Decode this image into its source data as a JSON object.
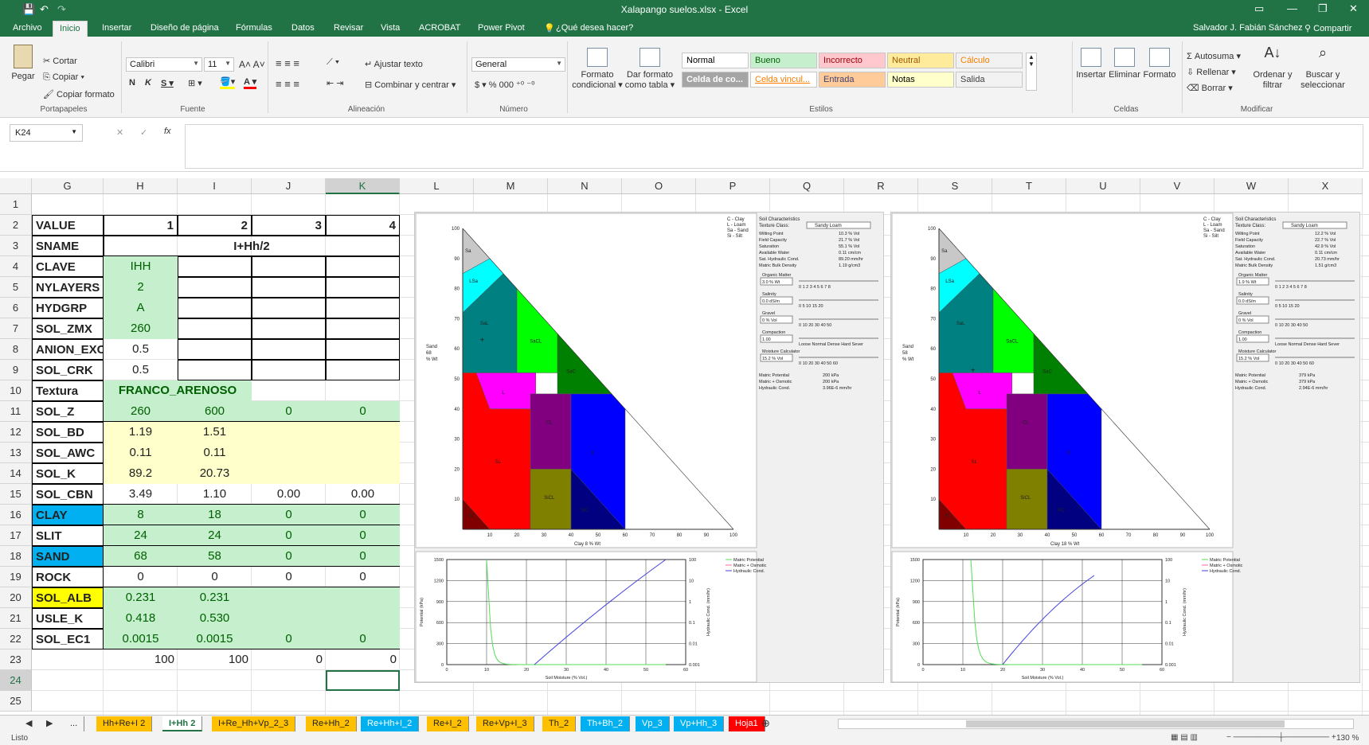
{
  "titlebar": {
    "title": "Xalapango suelos.xlsx - Excel",
    "save": "💾",
    "undo": "↶",
    "redo": "↷"
  },
  "ribbon_tabs": [
    "Archivo",
    "Inicio",
    "Insertar",
    "Diseño de página",
    "Fórmulas",
    "Datos",
    "Revisar",
    "Vista",
    "ACROBAT",
    "Power Pivot",
    "¿Qué desea hacer?"
  ],
  "user": {
    "name": "Salvador J. Fabián Sánchez",
    "share": "Compartir"
  },
  "clipboard": {
    "paste": "Pegar",
    "cut": "Cortar",
    "copy": "Copiar",
    "format_painter": "Copiar formato",
    "label": "Portapapeles"
  },
  "font": {
    "name": "Calibri",
    "size": "11",
    "label": "Fuente"
  },
  "alignment": {
    "wrap": "Ajustar texto",
    "merge": "Combinar y centrar",
    "label": "Alineación"
  },
  "number": {
    "format": "General",
    "label": "Número"
  },
  "styles": {
    "cond": "Formato condicional",
    "table": "Dar formato como tabla",
    "label": "Estilos",
    "cells": [
      "Normal",
      "Bueno",
      "Incorrecto",
      "Neutral",
      "Cálculo",
      "Celda de co...",
      "Celda vincul...",
      "Entrada",
      "Notas",
      "Salida"
    ],
    "colors": [
      "#ffffff",
      "#c6efce",
      "#ffc7ce",
      "#ffeb9c",
      "#f2f2f2",
      "#a5a5a5",
      "#ffffff",
      "#ffcc99",
      "#ffffcc",
      "#f2f2f2"
    ],
    "textcolors": [
      "#000000",
      "#006100",
      "#9c0006",
      "#9c5700",
      "#fa7d00",
      "#ffffff",
      "#fa7d00",
      "#3f3f76",
      "#000000",
      "#3f3f3f"
    ]
  },
  "cells_group": {
    "insert": "Insertar",
    "delete": "Eliminar",
    "format": "Formato",
    "label": "Celdas"
  },
  "editing": {
    "autosum": "Autosuma",
    "fill": "Rellenar",
    "clear": "Borrar",
    "sort": "Ordenar y filtrar",
    "find": "Buscar y seleccionar",
    "label": "Modificar"
  },
  "formula_bar": {
    "namebox": "K24",
    "fx": "fx",
    "content": ""
  },
  "columns": [
    "G",
    "H",
    "I",
    "J",
    "K",
    "L",
    "M",
    "N",
    "O",
    "P",
    "Q",
    "R",
    "S",
    "T",
    "U",
    "V",
    "W",
    "X"
  ],
  "rows": [
    "1",
    "2",
    "3",
    "4",
    "5",
    "6",
    "7",
    "8",
    "9",
    "10",
    "11",
    "12",
    "13",
    "14",
    "15",
    "16",
    "17",
    "18",
    "19",
    "20",
    "21",
    "22",
    "23",
    "24",
    "25"
  ],
  "table": {
    "labels": [
      "VALUE",
      "SNAME",
      "CLAVE",
      "NYLAYERS",
      "HYDGRP",
      "SOL_ZMX",
      "ANION_EXCL",
      "SOL_CRK",
      "Textura",
      "SOL_Z",
      "SOL_BD",
      "SOL_AWC",
      "SOL_K",
      "SOL_CBN",
      "CLAY",
      "SLIT",
      "SAND",
      "ROCK",
      "SOL_ALB",
      "USLE_K",
      "SOL_EC1"
    ],
    "value_row": [
      "1",
      "2",
      "3",
      "4"
    ],
    "sname": "I+Hh/2",
    "clave": "IHH",
    "nylayers": "2",
    "hydgrp": "A",
    "sol_zmx": "260",
    "anion_excl": "0.5",
    "sol_crk": "0.5",
    "textura": "FRANCO_ARENOSO",
    "sol_z": [
      "260",
      "600",
      "0",
      "0"
    ],
    "sol_bd": [
      "1.19",
      "1.51"
    ],
    "sol_awc": [
      "0.11",
      "0.11"
    ],
    "sol_k": [
      "89.2",
      "20.73"
    ],
    "sol_cbn": [
      "3.49",
      "1.10",
      "0.00",
      "0.00"
    ],
    "clay": [
      "8",
      "18",
      "0",
      "0"
    ],
    "slit": [
      "24",
      "24",
      "0",
      "0"
    ],
    "sand": [
      "68",
      "58",
      "0",
      "0"
    ],
    "rock": [
      "0",
      "0",
      "0",
      "0"
    ],
    "sol_alb": [
      "0.231",
      "0.231"
    ],
    "usle_k": [
      "0.418",
      "0.530"
    ],
    "sol_ec1": [
      "0.0015",
      "0.0015",
      "0",
      "0"
    ],
    "totals": [
      "100",
      "100",
      "0",
      "0"
    ]
  },
  "plots": [
    {
      "legend": [
        "C - Clay",
        "L - Loam",
        "Sa - Sand",
        "Si - Silt"
      ],
      "sand_label": "Sand",
      "sand_val": "68",
      "sand_unit": "% Wt",
      "clay_label": "Clay",
      "clay_val": "8",
      "clay_unit": "% Wt",
      "y_ticks": [
        "10",
        "20",
        "30",
        "40",
        "50",
        "60",
        "70",
        "80",
        "90",
        "100"
      ],
      "x_ticks": [
        "10",
        "20",
        "30",
        "40",
        "50",
        "60",
        "70",
        "80",
        "90",
        "100"
      ],
      "zones": [
        "Sa",
        "LSa",
        "SaL",
        "SaCL",
        "SaC",
        "L",
        "CL",
        "C",
        "SL",
        "SiCL",
        "SiC",
        "Si"
      ],
      "soil": {
        "header": "Soil Characteristics",
        "texture_class_label": "Texture Class:",
        "texture_class": "Sandy Loam",
        "rows": [
          [
            "Wilting Point",
            "10.3 % Vol"
          ],
          [
            "Field Capacity",
            "21.7 % Vol"
          ],
          [
            "Saturation",
            "55.1 % Vol"
          ],
          [
            "Available Water",
            "0.11 cm/cm"
          ],
          [
            "Sat. Hydraulic Cond.",
            "89.20 mm/hr"
          ],
          [
            "Matric Bulk Density",
            "1.19 g/cm3"
          ]
        ],
        "om_label": "Organic Matter",
        "om_val": "3.0 % Wt",
        "om_ticks": "0 1 2 3 4 5 6 7 8",
        "sal_label": "Salinity",
        "sal_val": "0.0 dS/m",
        "sal_ticks": "0 5 10 15 20",
        "grav_label": "Gravel",
        "grav_val": "0 % Vol",
        "grav_ticks": "0 10 20 30 40 50",
        "comp_label": "Compaction",
        "comp_val": "1.00",
        "comp_ticks": "Loose Normal Dense Hard Sever",
        "moist_label": "Moisture Calculator",
        "moist_val": "15.2 % Vol",
        "moist_ticks": "0 10 20 30 40 50 60",
        "moist_rows": [
          [
            "Matric Potential",
            "200 kPa"
          ],
          [
            "Matric + Osmotic",
            "200 kPa"
          ],
          [
            "Hydraulic Cond.",
            "3.96E-6 mm/hr"
          ]
        ]
      },
      "curve": {
        "legend": [
          "Matric Potential",
          "Matric + Osmotic",
          "Hydraulic Cond."
        ],
        "y_left": [
          "0",
          "300",
          "600",
          "900",
          "1200",
          "1500"
        ],
        "y_right": [
          "0.001",
          "0.01",
          "0.1",
          "1",
          "10",
          "100"
        ],
        "x": [
          "0",
          "10",
          "20",
          "30",
          "40",
          "50",
          "60"
        ],
        "xlabel": "Soil Moisture (% Vol.)",
        "ylabel": "Potential (kPa)",
        "y2label": "Hydraulic Cond. (mm/hr)"
      }
    },
    {
      "legend": [
        "C - Clay",
        "L - Loam",
        "Sa - Sand",
        "Si - Silt"
      ],
      "sand_label": "Sand",
      "sand_val": "58",
      "sand_unit": "% Wt",
      "clay_label": "Clay",
      "clay_val": "18",
      "clay_unit": "% Wt",
      "y_ticks": [
        "10",
        "20",
        "30",
        "40",
        "50",
        "60",
        "70",
        "80",
        "90",
        "100"
      ],
      "x_ticks": [
        "10",
        "20",
        "30",
        "40",
        "50",
        "60",
        "70",
        "80",
        "90",
        "100"
      ],
      "zones": [
        "Sa",
        "LSa",
        "SaL",
        "SaCL",
        "SaC",
        "L",
        "CL",
        "C",
        "SL",
        "SiCL",
        "SiC",
        "Si"
      ],
      "soil": {
        "header": "Soil Characteristics",
        "texture_class_label": "Texture Class:",
        "texture_class": "Sandy Loam",
        "rows": [
          [
            "Wilting Point",
            "12.2 % Vol"
          ],
          [
            "Field Capacity",
            "22.7 % Vol"
          ],
          [
            "Saturation",
            "42.9 % Vol"
          ],
          [
            "Available Water",
            "0.11 cm/cm"
          ],
          [
            "Sat. Hydraulic Cond.",
            "20.73 mm/hr"
          ],
          [
            "Matric Bulk Density",
            "1.51 g/cm3"
          ]
        ],
        "om_label": "Organic Matter",
        "om_val": "1.9 % Wt",
        "om_ticks": "0 1 2 3 4 5 6 7 8",
        "sal_label": "Salinity",
        "sal_val": "0.0 dS/m",
        "sal_ticks": "0 5 10 15 20",
        "grav_label": "Gravel",
        "grav_val": "0 % Vol",
        "grav_ticks": "0 10 20 30 40 50",
        "comp_label": "Compaction",
        "comp_val": "1.00",
        "comp_ticks": "Loose Normal Dense Hard Sever",
        "moist_label": "Moisture Calculator",
        "moist_val": "15.2 % Vol",
        "moist_ticks": "0 10 20 30 40 50 60",
        "moist_rows": [
          [
            "Matric Potential",
            "379 kPa"
          ],
          [
            "Matric + Osmotic",
            "379 kPa"
          ],
          [
            "Hydraulic Cond.",
            "2.94E-6 mm/hr"
          ]
        ]
      },
      "curve": {
        "legend": [
          "Matric Potential",
          "Matric + Osmotic",
          "Hydraulic Cond."
        ],
        "y_left": [
          "0",
          "300",
          "600",
          "900",
          "1200",
          "1500"
        ],
        "y_right": [
          "0.001",
          "0.01",
          "0.1",
          "1",
          "10",
          "100"
        ],
        "x": [
          "0",
          "10",
          "20",
          "30",
          "40",
          "50",
          "60"
        ],
        "xlabel": "Soil Moisture (% Vol.)",
        "ylabel": "Potential (kPa)",
        "y2label": "Hydraulic Cond. (mm/hr)"
      }
    }
  ],
  "sheet_tabs": [
    {
      "name": "...",
      "color": "#f3f3f3"
    },
    {
      "name": "Hh+Re+I 2",
      "color": "#ffc000"
    },
    {
      "name": "I+Hh 2",
      "color": "#ffffff"
    },
    {
      "name": "I+Re_Hh+Vp_2_3",
      "color": "#ffc000"
    },
    {
      "name": "Re+Hh_2",
      "color": "#ffc000"
    },
    {
      "name": "Re+Hh+I_2",
      "color": "#00b0f0"
    },
    {
      "name": "Re+I_2",
      "color": "#ffc000"
    },
    {
      "name": "Re+Vp+I_3",
      "color": "#ffc000"
    },
    {
      "name": "Th_2",
      "color": "#ffc000"
    },
    {
      "name": "Th+Bh_2",
      "color": "#00b0f0"
    },
    {
      "name": "Vp_3",
      "color": "#00b0f0"
    },
    {
      "name": "Vp+Hh_3",
      "color": "#00b0f0"
    },
    {
      "name": "Hoja1",
      "color": "#ff0000"
    }
  ],
  "status": {
    "ready": "Listo",
    "zoom": "130 %"
  }
}
